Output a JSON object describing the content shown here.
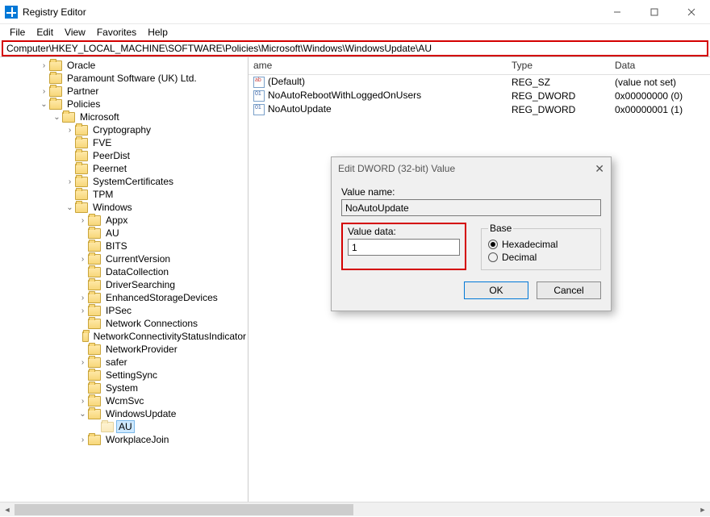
{
  "window": {
    "title": "Registry Editor",
    "buttons": {
      "min": "minimize",
      "max": "maximize",
      "close": "close"
    }
  },
  "menu": [
    "File",
    "Edit",
    "View",
    "Favorites",
    "Help"
  ],
  "address": "Computer\\HKEY_LOCAL_MACHINE\\SOFTWARE\\Policies\\Microsoft\\Windows\\WindowsUpdate\\AU",
  "tree": [
    {
      "indent": 3,
      "exp": ">",
      "label": "Oracle"
    },
    {
      "indent": 3,
      "exp": "",
      "label": "Paramount Software (UK) Ltd."
    },
    {
      "indent": 3,
      "exp": ">",
      "label": "Partner"
    },
    {
      "indent": 3,
      "exp": "v",
      "label": "Policies"
    },
    {
      "indent": 4,
      "exp": "v",
      "label": "Microsoft"
    },
    {
      "indent": 5,
      "exp": ">",
      "label": "Cryptography"
    },
    {
      "indent": 5,
      "exp": "",
      "label": "FVE"
    },
    {
      "indent": 5,
      "exp": "",
      "label": "PeerDist"
    },
    {
      "indent": 5,
      "exp": "",
      "label": "Peernet"
    },
    {
      "indent": 5,
      "exp": ">",
      "label": "SystemCertificates"
    },
    {
      "indent": 5,
      "exp": "",
      "label": "TPM"
    },
    {
      "indent": 5,
      "exp": "v",
      "label": "Windows"
    },
    {
      "indent": 6,
      "exp": ">",
      "label": "Appx"
    },
    {
      "indent": 6,
      "exp": "",
      "label": "AU"
    },
    {
      "indent": 6,
      "exp": "",
      "label": "BITS"
    },
    {
      "indent": 6,
      "exp": ">",
      "label": "CurrentVersion"
    },
    {
      "indent": 6,
      "exp": "",
      "label": "DataCollection"
    },
    {
      "indent": 6,
      "exp": "",
      "label": "DriverSearching"
    },
    {
      "indent": 6,
      "exp": ">",
      "label": "EnhancedStorageDevices"
    },
    {
      "indent": 6,
      "exp": ">",
      "label": "IPSec"
    },
    {
      "indent": 6,
      "exp": "",
      "label": "Network Connections"
    },
    {
      "indent": 6,
      "exp": "",
      "label": "NetworkConnectivityStatusIndicator"
    },
    {
      "indent": 6,
      "exp": "",
      "label": "NetworkProvider"
    },
    {
      "indent": 6,
      "exp": ">",
      "label": "safer"
    },
    {
      "indent": 6,
      "exp": "",
      "label": "SettingSync"
    },
    {
      "indent": 6,
      "exp": "",
      "label": "System"
    },
    {
      "indent": 6,
      "exp": ">",
      "label": "WcmSvc"
    },
    {
      "indent": 6,
      "exp": "v",
      "label": "WindowsUpdate"
    },
    {
      "indent": 7,
      "exp": "",
      "label": "AU",
      "selected": true,
      "cut": true
    },
    {
      "indent": 6,
      "exp": ">",
      "label": "WorkplaceJoin"
    }
  ],
  "columns": {
    "name": "ame",
    "type": "Type",
    "data": "Data"
  },
  "values": [
    {
      "icon": "sz",
      "name": "(Default)",
      "type": "REG_SZ",
      "data": "(value not set)"
    },
    {
      "icon": "dw",
      "name": "NoAutoRebootWithLoggedOnUsers",
      "type": "REG_DWORD",
      "data": "0x00000000 (0)"
    },
    {
      "icon": "dw",
      "name": "NoAutoUpdate",
      "type": "REG_DWORD",
      "data": "0x00000001 (1)"
    }
  ],
  "dialog": {
    "title": "Edit DWORD (32-bit) Value",
    "valueNameLabel": "Value name:",
    "valueName": "NoAutoUpdate",
    "valueDataLabel": "Value data:",
    "valueData": "1",
    "baseLabel": "Base",
    "hex": "Hexadecimal",
    "dec": "Decimal",
    "hexChecked": true,
    "ok": "OK",
    "cancel": "Cancel"
  }
}
